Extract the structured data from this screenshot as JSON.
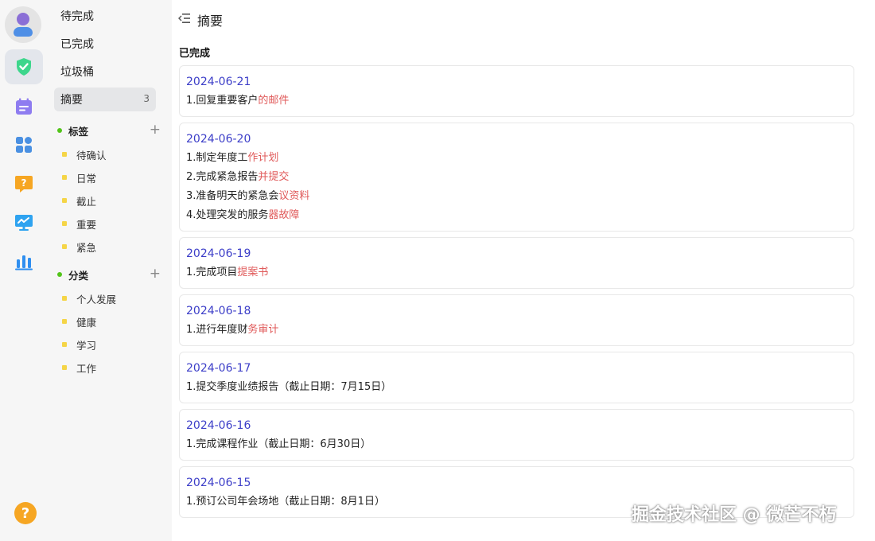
{
  "rail": {
    "icons": [
      "avatar-icon",
      "check-shield-icon",
      "calendar-icon",
      "apps-icon",
      "question-chat-icon",
      "monitor-chart-icon",
      "bar-chart-icon",
      "help-icon"
    ],
    "colors": {
      "active_bg": "#e3e6ec",
      "green": "#3dd68c",
      "purple": "#8e7cf0",
      "blue": "#4a90e2",
      "orange": "#f6a623",
      "cyan": "#2fa3f0"
    },
    "help_glyph": "?"
  },
  "nav": {
    "items": [
      {
        "label": "待完成"
      },
      {
        "label": "已完成"
      },
      {
        "label": "垃圾桶"
      },
      {
        "label": "摘要",
        "count": "3"
      }
    ],
    "tags": {
      "label": "标签",
      "plus": "+",
      "items": [
        "待确认",
        "日常",
        "截止",
        "重要",
        "紧急"
      ]
    },
    "categories": {
      "label": "分类",
      "plus": "+",
      "items": [
        "个人发展",
        "健康",
        "学习",
        "工作"
      ]
    }
  },
  "main": {
    "title": "摘要",
    "section": "已完成",
    "cards": [
      {
        "date": "2024-06-21",
        "tasks": [
          {
            "a": "1.回复重要客户",
            "b": "的邮件"
          }
        ]
      },
      {
        "date": "2024-06-20",
        "tasks": [
          {
            "a": "1.制定年度工",
            "b": "作计划"
          },
          {
            "a": "2.完成紧急报告",
            "b": "并提交"
          },
          {
            "a": "3.准备明天的紧急会",
            "b": "议资料"
          },
          {
            "a": "4.处理突发的服务",
            "b": "器故障"
          }
        ]
      },
      {
        "date": "2024-06-19",
        "tasks": [
          {
            "a": "1.完成项目",
            "b": "提案书"
          }
        ]
      },
      {
        "date": "2024-06-18",
        "tasks": [
          {
            "a": "1.进行年度财",
            "b": "务审计"
          }
        ]
      },
      {
        "date": "2024-06-17",
        "tasks": [
          {
            "a": "1.提交季度业绩报告（截止日期：7月15日）",
            "b": ""
          }
        ]
      },
      {
        "date": "2024-06-16",
        "tasks": [
          {
            "a": "1.完成课程作业（截止日期：6月30日）",
            "b": ""
          }
        ]
      },
      {
        "date": "2024-06-15",
        "tasks": [
          {
            "a": "1.预订公司年会场地（截止日期：8月1日）",
            "b": ""
          }
        ]
      }
    ]
  },
  "watermark": "掘金技术社区 @ 微芒不朽"
}
